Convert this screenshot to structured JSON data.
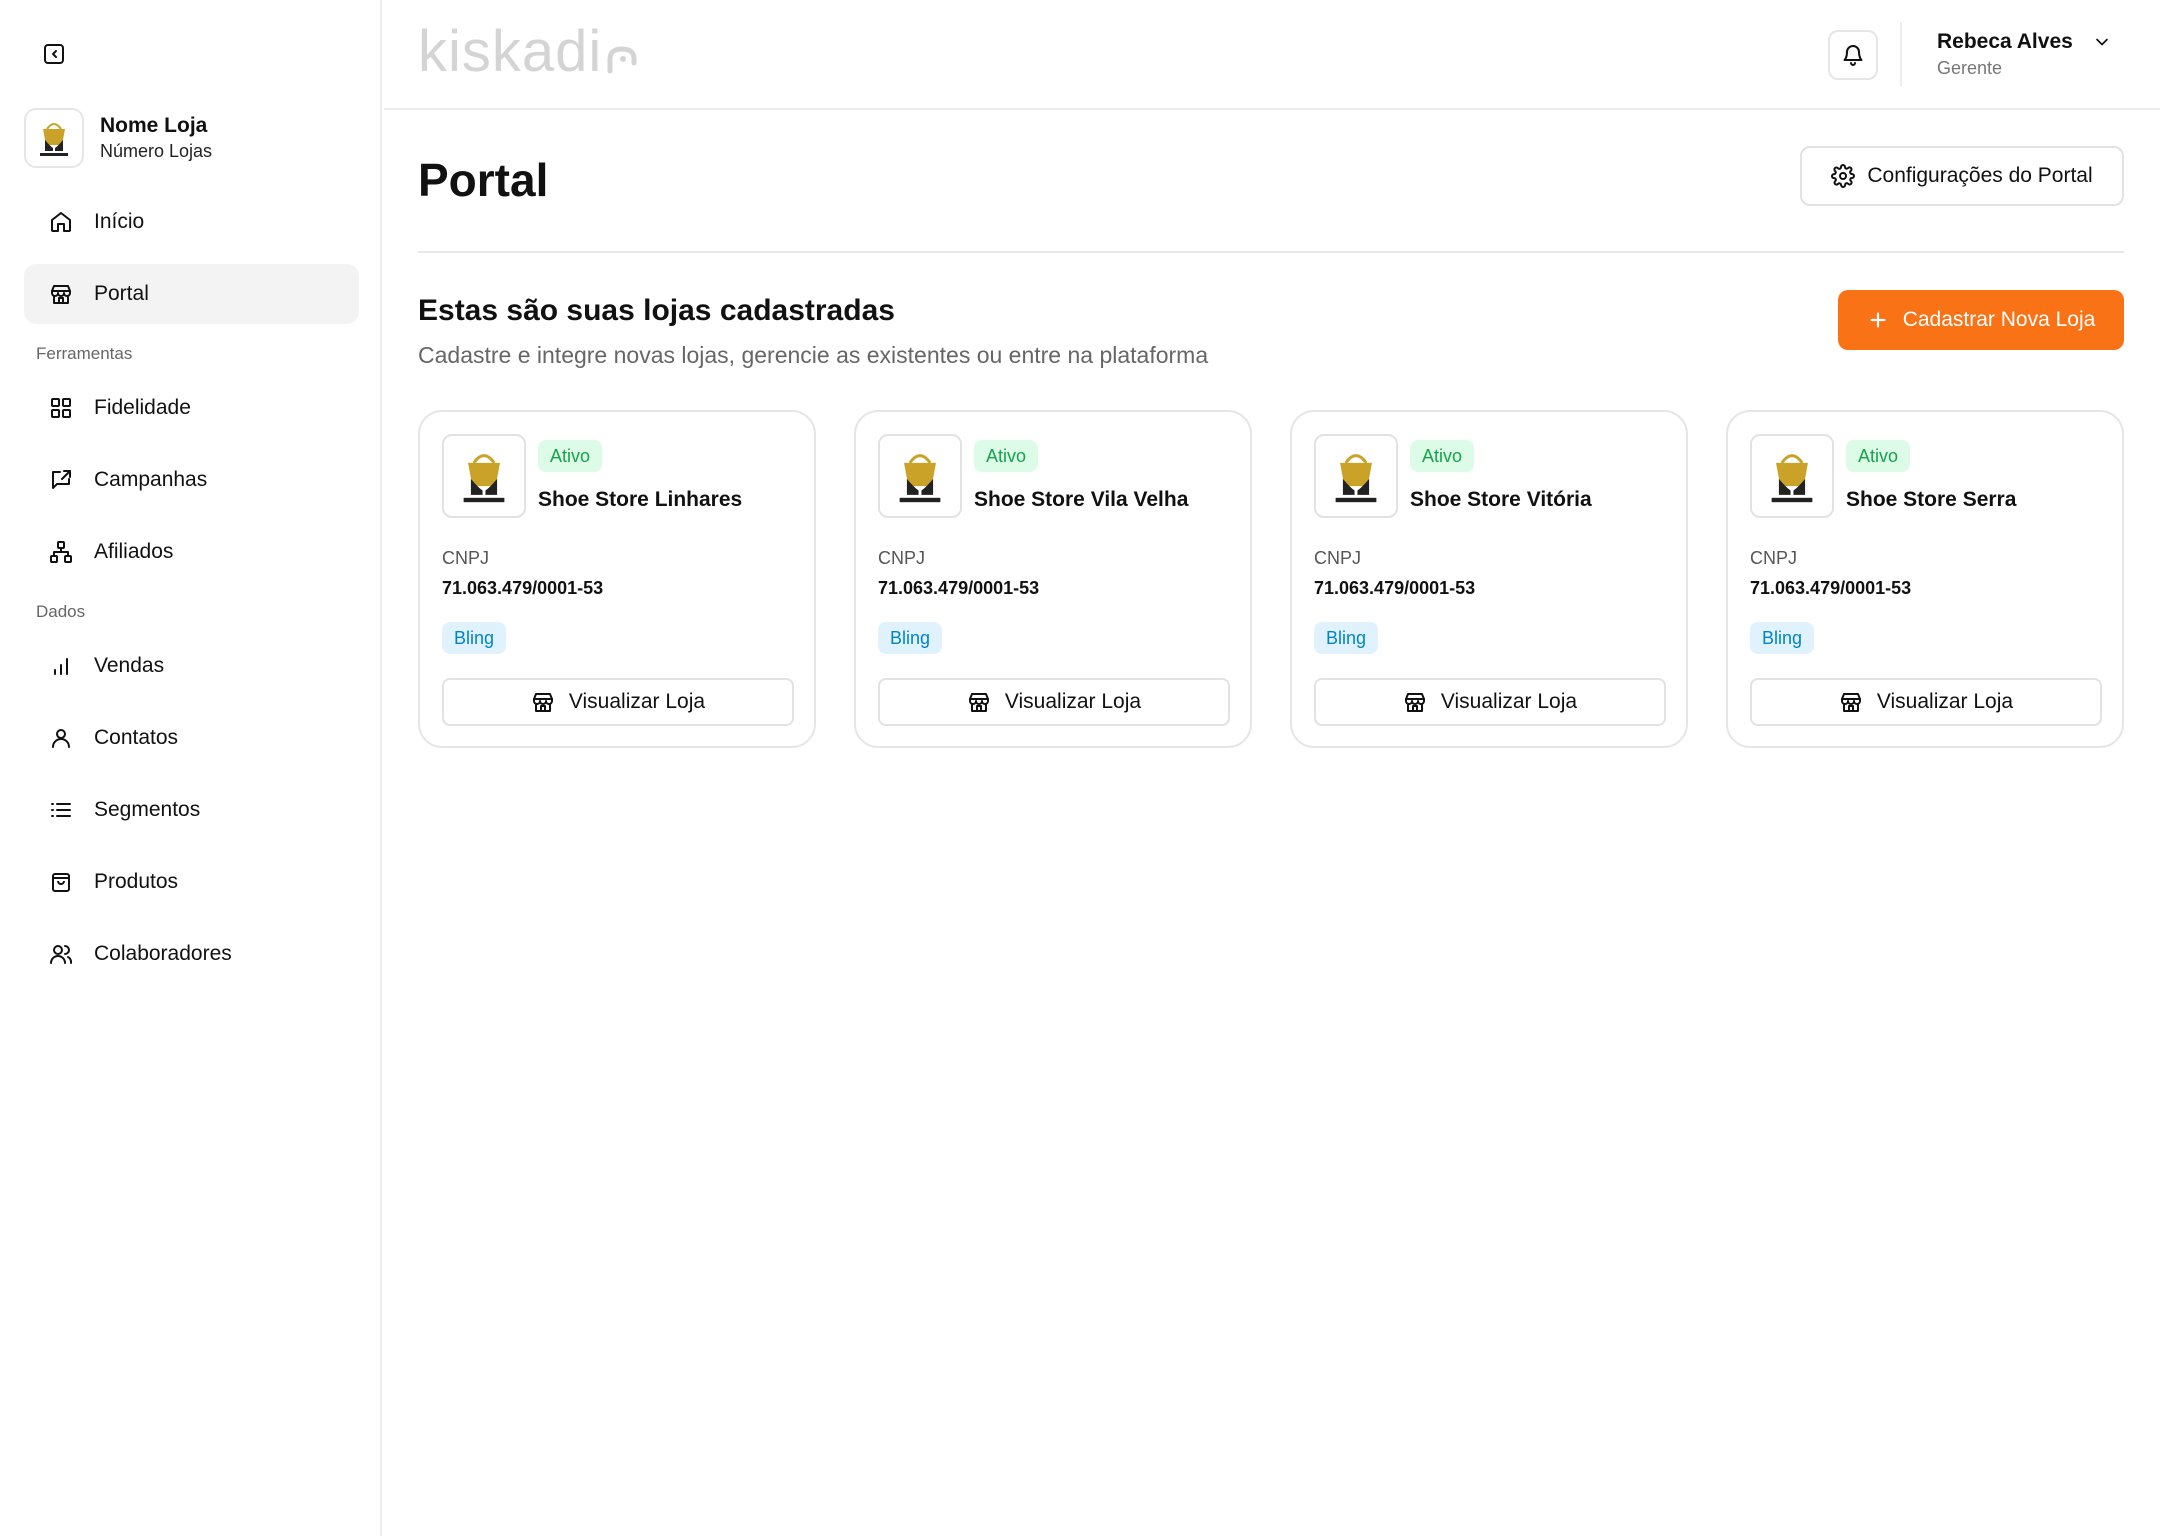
{
  "brand": {
    "name": "kiskadi"
  },
  "sidebar": {
    "store_name": "Nome Loja",
    "store_sub": "Número Lojas",
    "items": [
      {
        "label": "Início",
        "icon": "home-icon"
      },
      {
        "label": "Portal",
        "icon": "store-icon",
        "active": true
      }
    ],
    "sections": [
      {
        "title": "Ferramentas",
        "items": [
          {
            "label": "Fidelidade",
            "icon": "grid-icon"
          },
          {
            "label": "Campanhas",
            "icon": "share-icon"
          },
          {
            "label": "Afiliados",
            "icon": "network-icon"
          }
        ]
      },
      {
        "title": "Dados",
        "items": [
          {
            "label": "Vendas",
            "icon": "bar-chart-icon"
          },
          {
            "label": "Contatos",
            "icon": "user-icon"
          },
          {
            "label": "Segmentos",
            "icon": "list-icon"
          },
          {
            "label": "Produtos",
            "icon": "shopping-bag-icon"
          },
          {
            "label": "Colaboradores",
            "icon": "users-icon"
          }
        ]
      }
    ]
  },
  "header": {
    "user_name": "Rebeca Alves",
    "user_role": "Gerente"
  },
  "main": {
    "title": "Portal",
    "config_label": "Configurações do Portal",
    "section_title": "Estas são suas lojas cadastradas",
    "section_sub": "Cadastre e integre novas lojas, gerencie as existentes ou entre na plataforma",
    "new_store_label": "Cadastrar Nova Loja",
    "cards": [
      {
        "status": "Ativo",
        "name": "Shoe Store Linhares",
        "cnpj_label": "CNPJ",
        "cnpj": "71.063.479/0001-53",
        "integration": "Bling",
        "action": "Visualizar Loja"
      },
      {
        "status": "Ativo",
        "name": "Shoe Store Vila Velha",
        "cnpj_label": "CNPJ",
        "cnpj": "71.063.479/0001-53",
        "integration": "Bling",
        "action": "Visualizar Loja"
      },
      {
        "status": "Ativo",
        "name": "Shoe Store Vitória",
        "cnpj_label": "CNPJ",
        "cnpj": "71.063.479/0001-53",
        "integration": "Bling",
        "action": "Visualizar Loja"
      },
      {
        "status": "Ativo",
        "name": "Shoe Store Serra",
        "cnpj_label": "CNPJ",
        "cnpj": "71.063.479/0001-53",
        "integration": "Bling",
        "action": "Visualizar Loja"
      }
    ]
  },
  "colors": {
    "accent": "#f97316",
    "active_bg": "#dcfce7",
    "active_text": "#16a34a",
    "bling_bg": "#e0f2fe",
    "bling_text": "#0284c7",
    "logo_gold": "#c9a227"
  }
}
